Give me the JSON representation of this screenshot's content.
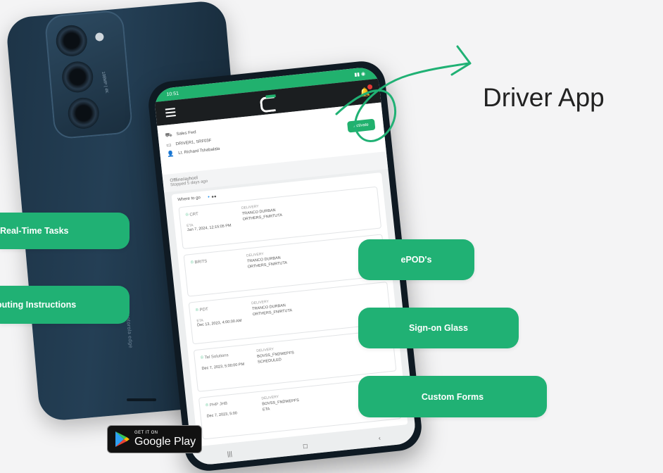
{
  "title": "Driver App",
  "features_left": [
    "Real-Time Tasks",
    "Routing Instructions"
  ],
  "features_right": [
    "ePOD's",
    "Sign-on Glass",
    "Custom Forms"
  ],
  "store_badge": {
    "small": "GET IT ON",
    "big": "Google Play"
  },
  "back_phone": {
    "camera_text": "108MP | 4K",
    "side_text": "motorola edge"
  },
  "front_phone": {
    "status_time": "10:51",
    "info_card": {
      "row1": "Sales Fwd",
      "row2": "DRIVER1, 5RF03F",
      "row3": "Lt. Richard Tshabalala",
      "activate_label": "Activate"
    },
    "driver_status": {
      "name": "Offline/ayhool",
      "sub": "Stopped 5 days ago"
    },
    "stops_header": {
      "label": "Where to go",
      "icons": "🔹●●"
    },
    "stops": [
      {
        "location": "CRT",
        "label": "DELIVERY",
        "line1": "TRANCO DURBAN",
        "line2": "ORTHERS_FNIRTUTA",
        "eta_label": "ETA",
        "eta": "Jan 7, 2024, 12:15:05 PM"
      },
      {
        "location": "BRITS",
        "label": "DELIVERY",
        "line1": "TRANCO DURBAN",
        "line2": "ORTHERS_FNIRTUTA",
        "eta_label": "",
        "eta": ""
      },
      {
        "location": "PDT",
        "label": "DELIVERY",
        "line1": "TRANCO DURBAN",
        "line2": "ORTHERS_FNIRTUTA",
        "eta_label": "ETA",
        "eta": "Dec 13, 2023, 4:00:00 AM"
      },
      {
        "location": "Tel Solutions",
        "label": "DELIVERY",
        "line1": "BOVSS_FNDWEPFS",
        "line2": "SCHEDULED",
        "eta_label": "",
        "eta": "Dec 7, 2023, 5:00:00 PM"
      },
      {
        "location": "PHP JHB",
        "label": "DELIVERY",
        "line1": "BOVSS_FNDWEPFS",
        "line2": "ETA",
        "eta_label": "",
        "eta": "Dec 7, 2023, 5:00"
      }
    ],
    "nav": [
      "|||",
      "◻",
      "‹"
    ]
  },
  "colors": {
    "accent": "#20b174",
    "phone_back": "#1d3447",
    "title_text": "#222222"
  }
}
